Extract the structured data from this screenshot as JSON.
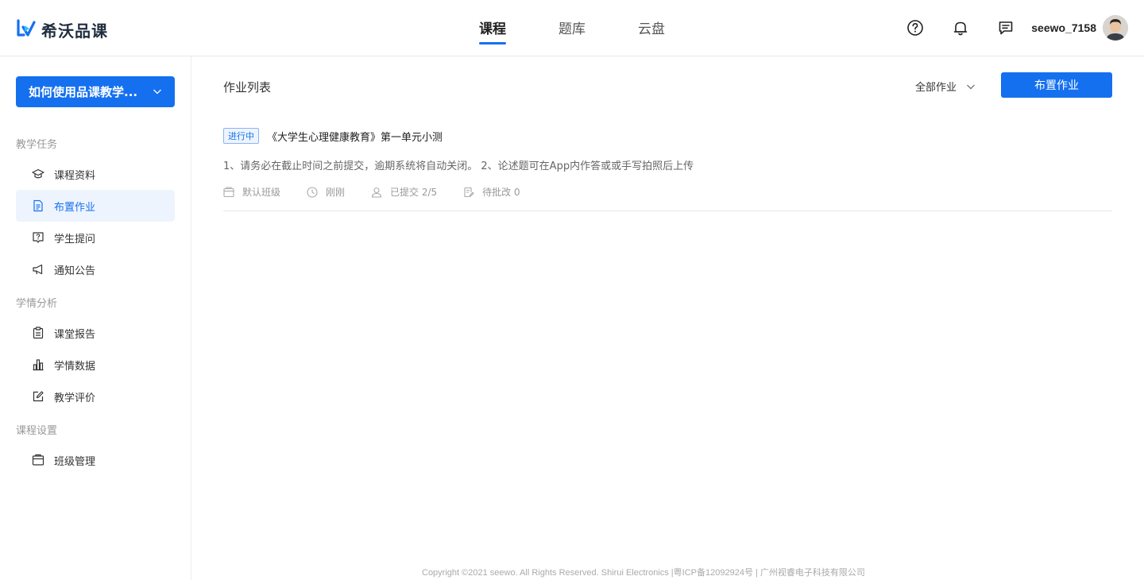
{
  "header": {
    "app_name": "希沃品课",
    "nav": [
      {
        "label": "课程",
        "active": true
      },
      {
        "label": "题库",
        "active": false
      },
      {
        "label": "云盘",
        "active": false
      }
    ],
    "username": "seewo_7158",
    "icons": [
      "help-icon",
      "bell-icon",
      "message-icon"
    ]
  },
  "sidebar": {
    "course_name": "如何使用品课教学...",
    "groups": [
      {
        "label": "教学任务",
        "items": [
          {
            "label": "课程资料",
            "icon": "graduation-cap-icon",
            "active": false
          },
          {
            "label": "布置作业",
            "icon": "document-icon",
            "active": true
          },
          {
            "label": "学生提问",
            "icon": "question-bubble-icon",
            "active": false
          },
          {
            "label": "通知公告",
            "icon": "megaphone-icon",
            "active": false
          }
        ]
      },
      {
        "label": "学情分析",
        "items": [
          {
            "label": "课堂报告",
            "icon": "clipboard-icon",
            "active": false
          },
          {
            "label": "学情数据",
            "icon": "bar-chart-icon",
            "active": false
          },
          {
            "label": "教学评价",
            "icon": "edit-icon",
            "active": false
          }
        ]
      },
      {
        "label": "课程设置",
        "items": [
          {
            "label": "班级管理",
            "icon": "class-box-icon",
            "active": false
          }
        ]
      }
    ]
  },
  "main": {
    "title": "作业列表",
    "filter_label": "全部作业",
    "primary_button": "布置作业",
    "homework": [
      {
        "status": "进行中",
        "title": "《大学生心理健康教育》第一单元小测",
        "description": "1、请务必在截止时间之前提交，逾期系统将自动关闭。 2、论述题可在App内作答或或手写拍照后上传",
        "meta": {
          "class_name": "默认班级",
          "time": "刚刚",
          "submitted": "已提交 2/5",
          "to_grade": "待批改 0"
        }
      }
    ]
  },
  "footer": "Copyright ©2021 seewo. All Rights Reserved. Shirui Electronics |粤ICP备12092924号 | 广州视睿电子科技有限公司",
  "colors": {
    "primary": "#1570ef",
    "active_bg": "#eef4fe"
  }
}
